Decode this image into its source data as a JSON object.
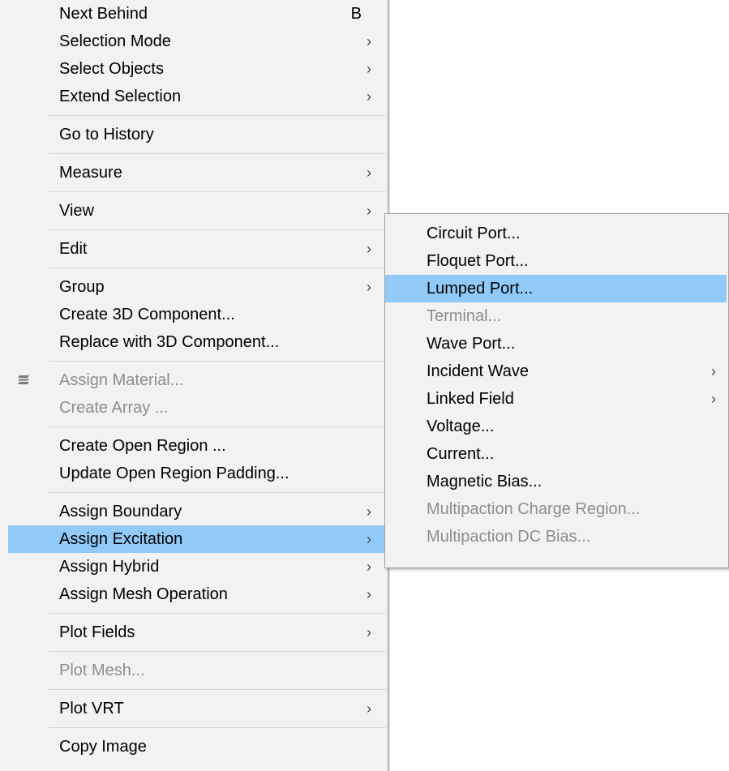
{
  "main_menu": {
    "sections": [
      [
        {
          "label": "Next Behind",
          "shortcut": "B"
        },
        {
          "label": "Selection Mode",
          "submenu": true
        },
        {
          "label": "Select Objects",
          "submenu": true
        },
        {
          "label": "Extend Selection",
          "submenu": true
        }
      ],
      [
        {
          "label": "Go to History"
        }
      ],
      [
        {
          "label": "Measure",
          "submenu": true
        }
      ],
      [
        {
          "label": "View",
          "submenu": true
        }
      ],
      [
        {
          "label": "Edit",
          "submenu": true
        }
      ],
      [
        {
          "label": "Group",
          "submenu": true
        },
        {
          "label": "Create 3D Component..."
        },
        {
          "label": "Replace with 3D Component..."
        }
      ],
      [
        {
          "label": "Assign Material...",
          "disabled": true,
          "icon": "material-layers-icon"
        },
        {
          "label": "Create Array ...",
          "disabled": true
        }
      ],
      [
        {
          "label": "Create Open Region ..."
        },
        {
          "label": "Update Open Region Padding..."
        }
      ],
      [
        {
          "label": "Assign Boundary",
          "submenu": true
        },
        {
          "label": "Assign Excitation",
          "submenu": true,
          "highlighted": true
        },
        {
          "label": "Assign Hybrid",
          "submenu": true
        },
        {
          "label": "Assign Mesh Operation",
          "submenu": true
        }
      ],
      [
        {
          "label": "Plot Fields",
          "submenu": true
        }
      ],
      [
        {
          "label": "Plot Mesh...",
          "disabled": true
        }
      ],
      [
        {
          "label": "Plot VRT",
          "submenu": true
        }
      ],
      [
        {
          "label": "Copy Image"
        }
      ]
    ]
  },
  "sub_menu": {
    "items": [
      {
        "label": "Circuit Port..."
      },
      {
        "label": "Floquet Port..."
      },
      {
        "label": "Lumped Port...",
        "highlighted": true
      },
      {
        "label": "Terminal...",
        "disabled": true
      },
      {
        "label": "Wave Port..."
      },
      {
        "label": "Incident Wave",
        "submenu": true
      },
      {
        "label": "Linked Field",
        "submenu": true
      },
      {
        "label": "Voltage..."
      },
      {
        "label": "Current..."
      },
      {
        "label": "Magnetic Bias..."
      },
      {
        "label": "Multipaction Charge Region...",
        "disabled": true
      },
      {
        "label": "Multipaction DC Bias...",
        "disabled": true
      }
    ]
  },
  "glyphs": {
    "submenu_arrow": "›"
  },
  "colors": {
    "highlight": "#91c9f7",
    "disabled_text": "#8d8d8d",
    "menu_bg": "#f2f2f2"
  }
}
